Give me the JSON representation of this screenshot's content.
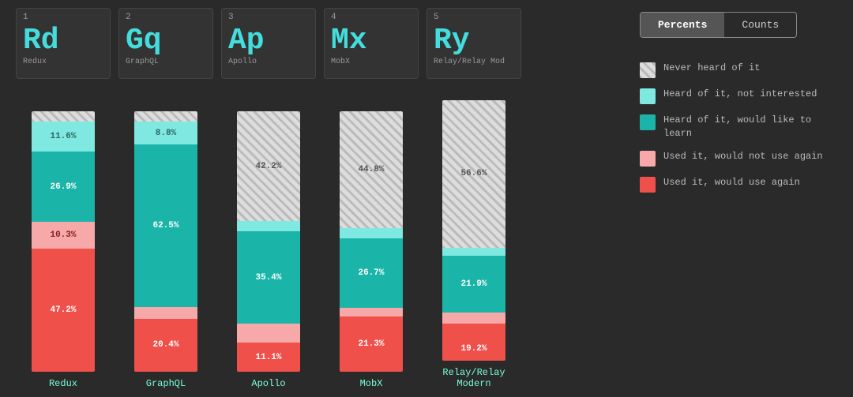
{
  "cards": [
    {
      "number": "1",
      "abbr": "Rd",
      "name": "Redux"
    },
    {
      "number": "2",
      "abbr": "Gq",
      "name": "GraphQL"
    },
    {
      "number": "3",
      "abbr": "Ap",
      "name": "Apollo"
    },
    {
      "number": "4",
      "abbr": "Mx",
      "name": "MobX"
    },
    {
      "number": "5",
      "abbr": "Ry",
      "name": "Relay/Relay Mod"
    }
  ],
  "charts": [
    {
      "label": "Redux",
      "segments": [
        {
          "type": "never",
          "pct": 4.0,
          "label": ""
        },
        {
          "type": "heard-not",
          "pct": 11.6,
          "label": "11.6%"
        },
        {
          "type": "heard-learn",
          "pct": 26.9,
          "label": "26.9%"
        },
        {
          "type": "used-not",
          "pct": 10.3,
          "label": "10.3%"
        },
        {
          "type": "used-yes",
          "pct": 47.2,
          "label": "47.2%"
        }
      ]
    },
    {
      "label": "GraphQL",
      "segments": [
        {
          "type": "never",
          "pct": 4.0,
          "label": ""
        },
        {
          "type": "heard-not",
          "pct": 8.8,
          "label": "8.8%"
        },
        {
          "type": "heard-learn",
          "pct": 62.5,
          "label": "62.5%"
        },
        {
          "type": "used-not",
          "pct": 4.3,
          "label": ""
        },
        {
          "type": "used-yes",
          "pct": 20.4,
          "label": "20.4%"
        }
      ]
    },
    {
      "label": "Apollo",
      "segments": [
        {
          "type": "never",
          "pct": 42.2,
          "label": "42.2%"
        },
        {
          "type": "heard-not",
          "pct": 4.0,
          "label": ""
        },
        {
          "type": "heard-learn",
          "pct": 35.4,
          "label": "35.4%"
        },
        {
          "type": "used-not",
          "pct": 7.3,
          "label": ""
        },
        {
          "type": "used-yes",
          "pct": 11.1,
          "label": "11.1%"
        }
      ]
    },
    {
      "label": "MobX",
      "segments": [
        {
          "type": "never",
          "pct": 44.8,
          "label": "44.8%"
        },
        {
          "type": "heard-not",
          "pct": 4.0,
          "label": ""
        },
        {
          "type": "heard-learn",
          "pct": 26.7,
          "label": "26.7%"
        },
        {
          "type": "used-not",
          "pct": 3.2,
          "label": ""
        },
        {
          "type": "used-yes",
          "pct": 21.3,
          "label": "21.3%"
        }
      ]
    },
    {
      "label": "Relay/Relay Modern",
      "segments": [
        {
          "type": "never",
          "pct": 56.6,
          "label": "56.6%"
        },
        {
          "type": "heard-not",
          "pct": 3.0,
          "label": ""
        },
        {
          "type": "heard-learn",
          "pct": 21.9,
          "label": "21.9%"
        },
        {
          "type": "used-not",
          "pct": 4.3,
          "label": ""
        },
        {
          "type": "used-yes",
          "pct": 19.2,
          "label": "19.2%"
        }
      ]
    }
  ],
  "toggle": {
    "percents": "Percents",
    "counts": "Counts"
  },
  "legend": [
    {
      "type": "never",
      "text": "Never heard of it"
    },
    {
      "type": "heard-not",
      "text": "Heard of it, not interested"
    },
    {
      "type": "heard-learn",
      "text": "Heard of it, would like to learn"
    },
    {
      "type": "used-not",
      "text": "Used it, would not use again"
    },
    {
      "type": "used-yes",
      "text": "Used it, would use again"
    }
  ]
}
